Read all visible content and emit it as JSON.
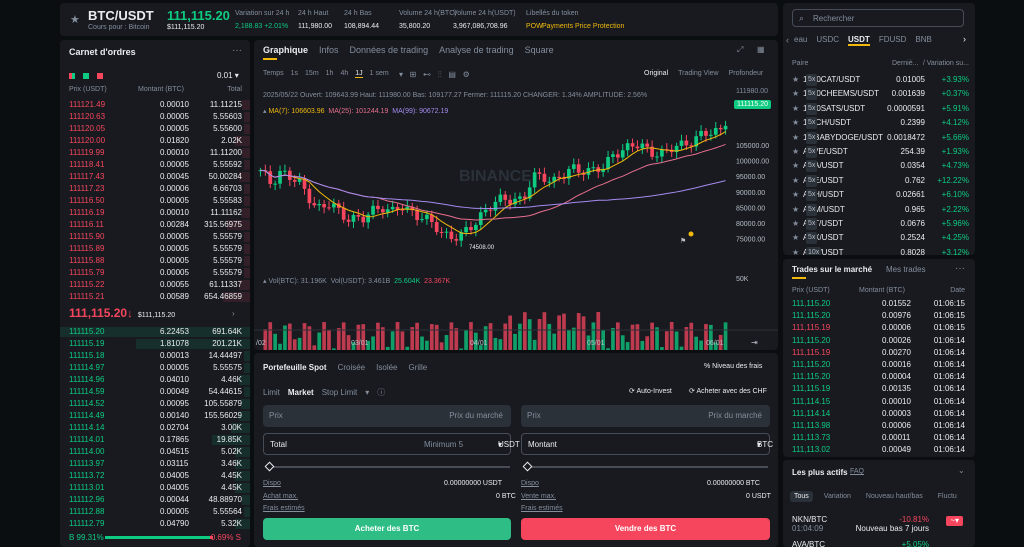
{
  "colors": {
    "up": "#0ecb81",
    "down": "#f6465d",
    "accent": "#f0b90b",
    "bg": "#0b0e11",
    "panel": "#181a20"
  },
  "header": {
    "star_icon": "star-icon",
    "symbol": "BTC/USDT",
    "sub": "Cours pour : Bitcoin",
    "price": "111,115.20",
    "price_usd": "$111,115.20",
    "stats": [
      {
        "label": "Variation sur 24 h",
        "value": "2,188.83 +2.01%"
      },
      {
        "label": "24 h Haut",
        "value": "111,980.00"
      },
      {
        "label": "24 h Bas",
        "value": "108,894.44"
      },
      {
        "label": "Volume 24 h(BTC)",
        "value": "35,800.20"
      },
      {
        "label": "Volume 24 h(USDT)",
        "value": "3,967,086,708.96"
      },
      {
        "label": "Libellés du token",
        "value": ""
      }
    ],
    "tags": [
      "POW",
      "Payments",
      "Price Protection"
    ]
  },
  "orderbook": {
    "title": "Carnet d'ordres",
    "more": "···",
    "precision": "0.01",
    "cols": [
      "Prix (USDT)",
      "Montant (BTC)",
      "Total"
    ],
    "asks": [
      [
        "111121.49",
        "0.00010",
        "11.11215"
      ],
      [
        "111120.63",
        "0.00005",
        "5.55603"
      ],
      [
        "111120.05",
        "0.00005",
        "5.55600"
      ],
      [
        "111120.00",
        "0.01820",
        "2.02K"
      ],
      [
        "111119.99",
        "0.00010",
        "11.11200"
      ],
      [
        "111118.41",
        "0.00005",
        "5.55592"
      ],
      [
        "111117.43",
        "0.00045",
        "50.00284"
      ],
      [
        "111117.23",
        "0.00006",
        "6.66703"
      ],
      [
        "111116.50",
        "0.00005",
        "5.55583"
      ],
      [
        "111116.19",
        "0.00010",
        "11.11162"
      ],
      [
        "111116.11",
        "0.00284",
        "315.56975"
      ],
      [
        "111115.90",
        "0.00005",
        "5.55579"
      ],
      [
        "111115.89",
        "0.00005",
        "5.55579"
      ],
      [
        "111115.88",
        "0.00005",
        "5.55579"
      ],
      [
        "111115.79",
        "0.00005",
        "5.55579"
      ],
      [
        "111115.22",
        "0.00055",
        "61.11337"
      ],
      [
        "111115.21",
        "0.00589",
        "654.46859"
      ]
    ],
    "mid": "111,115.20",
    "mid_arrow": "↓",
    "mid_usd": "$111,115.20",
    "bids": [
      [
        "111115.20",
        "6.22453",
        "691.64K"
      ],
      [
        "111115.19",
        "1.81078",
        "201.21K"
      ],
      [
        "111115.18",
        "0.00013",
        "14.44497"
      ],
      [
        "111114.97",
        "0.00005",
        "5.55575"
      ],
      [
        "111114.96",
        "0.04010",
        "4.46K"
      ],
      [
        "111114.59",
        "0.00049",
        "54.44615"
      ],
      [
        "111114.52",
        "0.00095",
        "105.55879"
      ],
      [
        "111114.49",
        "0.00140",
        "155.56029"
      ],
      [
        "111114.14",
        "0.02704",
        "3.00K"
      ],
      [
        "111114.01",
        "0.17865",
        "19.85K"
      ],
      [
        "111114.00",
        "0.04515",
        "5.02K"
      ],
      [
        "111113.97",
        "0.03115",
        "3.46K"
      ],
      [
        "111113.72",
        "0.04005",
        "4.45K"
      ],
      [
        "111113.01",
        "0.04005",
        "4.45K"
      ],
      [
        "111112.96",
        "0.00044",
        "48.88970"
      ],
      [
        "111112.88",
        "0.00005",
        "5.55564"
      ],
      [
        "111112.79",
        "0.04790",
        "5.32K"
      ]
    ],
    "buy_pct": "B 99.31%",
    "sell_pct": "0.69% S"
  },
  "chart": {
    "tabs": [
      "Graphique",
      "Infos",
      "Données de trading",
      "Analyse de trading",
      "Square"
    ],
    "intervals": [
      "Temps",
      "1s",
      "15m",
      "1h",
      "4h",
      "1J",
      "1 sem"
    ],
    "views": [
      "Original",
      "Trading View",
      "Profondeur"
    ],
    "ohlc": "2025/05/22 Ouvert: 109643.99 Haut: 111980.00 Bas: 109177.27 Fermer: 111115.20 CHANGER: 1.34% AMPLITUDE: 2.56%",
    "ma": [
      "MA(7): 106603.96",
      "MA(25): 101244.19",
      "MA(99): 90672.19"
    ],
    "vol": [
      "Vol(BTC): 31.196K",
      "Vol(USDT): 3.461B",
      "25.604K",
      "23.367K"
    ],
    "yticks": [
      "105000.00",
      "100000.00",
      "95000.00",
      "90000.00",
      "85000.00",
      "80000.00",
      "75000.00"
    ],
    "vol_tick": "50K",
    "xticks": [
      "/02",
      "03/01",
      "04/01",
      "05/01",
      "06/01"
    ],
    "price_tag": "111115.20",
    "low_label": "74508.00",
    "high_label": "111980.00",
    "watermark": "BINANCE"
  },
  "chart_data": {
    "type": "candlestick",
    "ylim": [
      72000,
      113000
    ],
    "last": 111115.2,
    "low": 74508,
    "high": 111980
  },
  "trade": {
    "tabs": [
      "Portefeuille Spot",
      "Croisée",
      "Isolée",
      "Grille"
    ],
    "fees": "Niveau des frais",
    "order_types": [
      "Limit",
      "Market",
      "Stop Limit"
    ],
    "auto_invest": "Auto-Invest",
    "buy_chf": "Acheter avec des CHF",
    "buy": {
      "price_label": "Prix",
      "price_val": "Prix du marché",
      "total_label": "Total",
      "min": "Minimum 5",
      "cur": "USDT",
      "dispo": "Dispo",
      "dispo_val": "0.00000000 USDT",
      "max": "Achat max.",
      "max_val": "0 BTC",
      "fees": "Frais estimés",
      "button": "Acheter des BTC"
    },
    "sell": {
      "price_label": "Prix",
      "price_val": "Prix du marché",
      "amount_label": "Montant",
      "cur": "BTC",
      "dispo": "Dispo",
      "dispo_val": "0.00000000 BTC",
      "max": "Vente max.",
      "max_val": "0 USDT",
      "fees": "Frais estimés",
      "button": "Vendre des BTC"
    }
  },
  "markets": {
    "search_placeholder": "Rechercher",
    "tabs": [
      "eau",
      "USDC",
      "USDT",
      "FDUSD",
      "BNB"
    ],
    "cols": [
      "Paire",
      "Derniè...",
      "/ Variation su..."
    ],
    "rows": [
      [
        "1000CAT/USDT",
        "5x",
        "0.01005",
        "+3.93%",
        "g"
      ],
      [
        "1000CHEEMS/USDT",
        "5x",
        "0.001639",
        "+0.37%",
        "g"
      ],
      [
        "1000SATS/USDT",
        "5x",
        "0.0000591",
        "+5.91%",
        "g"
      ],
      [
        "1INCH/USDT",
        "5x",
        "0.2399",
        "+4.12%",
        "g"
      ],
      [
        "1MBABYDOGE/USDT",
        "5x",
        "0.0018472",
        "+5.66%",
        "g"
      ],
      [
        "AAVE/USDT",
        "5x",
        "254.39",
        "+1.93%",
        "g"
      ],
      [
        "ACA/USDT",
        "5x",
        "0.0354",
        "+4.73%",
        "g"
      ],
      [
        "ACE/USDT",
        "5x",
        "0.762",
        "+12.22%",
        "g"
      ],
      [
        "ACH/USDT",
        "5x",
        "0.02661",
        "+6.10%",
        "g"
      ],
      [
        "ACM/USDT",
        "5x",
        "0.965",
        "+2.22%",
        "g"
      ],
      [
        "ACT/USDT",
        "5x",
        "0.0676",
        "+5.96%",
        "g"
      ],
      [
        "ACX/USDT",
        "5x",
        "0.2524",
        "+4.25%",
        "g"
      ],
      [
        "ADA/USDT",
        "10x",
        "0.8028",
        "+3.12%",
        "g"
      ]
    ]
  },
  "trades": {
    "tabs": [
      "Trades sur le marché",
      "Mes trades"
    ],
    "cols": [
      "Prix (USDT)",
      "Montant (BTC)",
      "Date"
    ],
    "rows": [
      [
        "111,115.20",
        "0.01552",
        "01:06:15",
        "g"
      ],
      [
        "111,115.20",
        "0.00976",
        "01:06:15",
        "g"
      ],
      [
        "111,115.19",
        "0.00006",
        "01:06:15",
        "r"
      ],
      [
        "111,115.20",
        "0.00026",
        "01:06:14",
        "g"
      ],
      [
        "111,115.19",
        "0.00270",
        "01:06:14",
        "r"
      ],
      [
        "111,115.20",
        "0.00016",
        "01:06:14",
        "g"
      ],
      [
        "111,115.20",
        "0.00004",
        "01:06:14",
        "g"
      ],
      [
        "111,115.19",
        "0.00135",
        "01:06:14",
        "g"
      ],
      [
        "111,114.15",
        "0.00010",
        "01:06:14",
        "g"
      ],
      [
        "111,114.14",
        "0.00003",
        "01:06:14",
        "g"
      ],
      [
        "111,113.98",
        "0.00006",
        "01:06:14",
        "g"
      ],
      [
        "111,113.73",
        "0.00011",
        "01:06:14",
        "g"
      ],
      [
        "111,113.02",
        "0.00049",
        "01:06:14",
        "g"
      ]
    ]
  },
  "active": {
    "title": "Les plus actifs",
    "faq": "FAQ",
    "tabs": [
      "Tous",
      "Variation",
      "Nouveau haut/bas",
      "Fluctu"
    ],
    "rows": [
      {
        "pair": "NKN/BTC",
        "time": "01:04:09",
        "change": "-10.81%",
        "note": "Nouveau bas 7 jours",
        "c": "r"
      },
      {
        "pair": "AVA/BTC",
        "time": "",
        "change": "+5.05%",
        "note": "",
        "c": "g"
      }
    ]
  }
}
